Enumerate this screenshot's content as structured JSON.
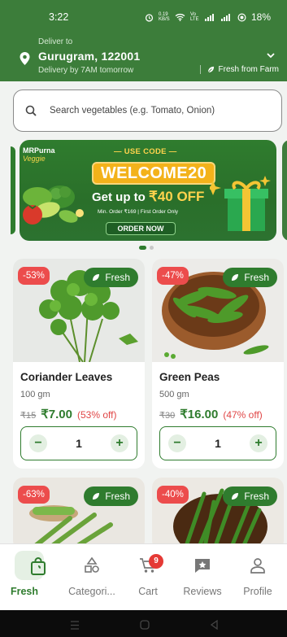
{
  "status_bar": {
    "time": "3:22",
    "data_speed": "0.19 KB/S",
    "network": "Vo LTE",
    "battery": "18%"
  },
  "header": {
    "deliver_to_label": "Deliver to",
    "location": "Gurugram, 122001",
    "delivery_eta": "Delivery by 7AM tomorrow",
    "fresh_label": "Fresh from Farm"
  },
  "search": {
    "placeholder": "Search vegetables (e.g. Tomato, Onion)"
  },
  "banner": {
    "brand": "MRPurna",
    "brand_sub": "Veggie",
    "use_code_label": "USE CODE",
    "promo_code": "WELCOME20",
    "offer_prefix": "Get up to",
    "offer_amount": "₹40 OFF",
    "min_order": "Min. Order ₹169 | First Order Only",
    "cta": "ORDER NOW"
  },
  "products": [
    {
      "name": "Coriander Leaves",
      "quantity": "100 gm",
      "mrp": "₹15",
      "price": "₹7.00",
      "discount_text": "(53% off)",
      "badge": "-53%",
      "tag": "Fresh",
      "count": "1"
    },
    {
      "name": "Green Peas",
      "quantity": "500 gm",
      "mrp": "₹30",
      "price": "₹16.00",
      "discount_text": "(47% off)",
      "badge": "-47%",
      "tag": "Fresh",
      "count": "1"
    },
    {
      "badge": "-63%",
      "tag": "Fresh"
    },
    {
      "badge": "-40%",
      "tag": "Fresh"
    }
  ],
  "bottom_nav": [
    {
      "label": "Fresh",
      "active": true
    },
    {
      "label": "Categori..."
    },
    {
      "label": "Cart",
      "badge": "9"
    },
    {
      "label": "Reviews"
    },
    {
      "label": "Profile"
    }
  ],
  "colors": {
    "brand_green": "#3c7d3a",
    "accent_green": "#2f7c2e",
    "discount_red": "#ec4c4c",
    "promo_yellow": "#f3b21a"
  }
}
